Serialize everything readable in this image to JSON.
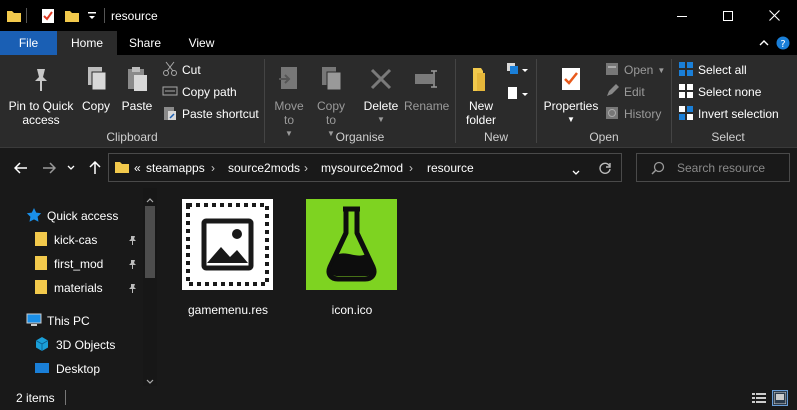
{
  "window": {
    "title": "resource",
    "controls": {
      "minimize": "minimize-icon",
      "maximize": "maximize-icon",
      "close": "close-icon"
    }
  },
  "tabs": [
    "File",
    "Home",
    "Share",
    "View"
  ],
  "active_tab": "Home",
  "ribbon": {
    "clipboard": {
      "group_label": "Clipboard",
      "pin_label": "Pin to Quick access",
      "copy_label": "Copy",
      "paste_label": "Paste",
      "cut_label": "Cut",
      "copy_path_label": "Copy path",
      "paste_shortcut_label": "Paste shortcut"
    },
    "organise": {
      "group_label": "Organise",
      "move_to_label": "Move to",
      "copy_to_label": "Copy to",
      "delete_label": "Delete",
      "rename_label": "Rename"
    },
    "new": {
      "group_label": "New",
      "new_folder_label": "New folder"
    },
    "open": {
      "group_label": "Open",
      "properties_label": "Properties",
      "open_label": "Open",
      "edit_label": "Edit",
      "history_label": "History"
    },
    "select": {
      "group_label": "Select",
      "select_all_label": "Select all",
      "select_none_label": "Select none",
      "invert_label": "Invert selection"
    }
  },
  "address": {
    "overflow": "«",
    "breadcrumbs": [
      "steamapps",
      "source2mods",
      "mysource2mod",
      "resource"
    ]
  },
  "search": {
    "placeholder": "Search resource"
  },
  "nav_pane": {
    "quick_access": "Quick access",
    "pinned": [
      "kick-cas",
      "first_mod",
      "materials"
    ],
    "this_pc": "This PC",
    "pc_items": [
      "3D Objects",
      "Desktop"
    ]
  },
  "files": [
    {
      "name": "gamemenu.res",
      "icon": "image-file-icon"
    },
    {
      "name": "icon.ico",
      "icon": "flask-icon"
    }
  ],
  "status": {
    "item_count": "2 items"
  },
  "colors": {
    "accent": "#1a5fb4",
    "folder": "#f2c94c",
    "icon_green": "#7ed321"
  }
}
